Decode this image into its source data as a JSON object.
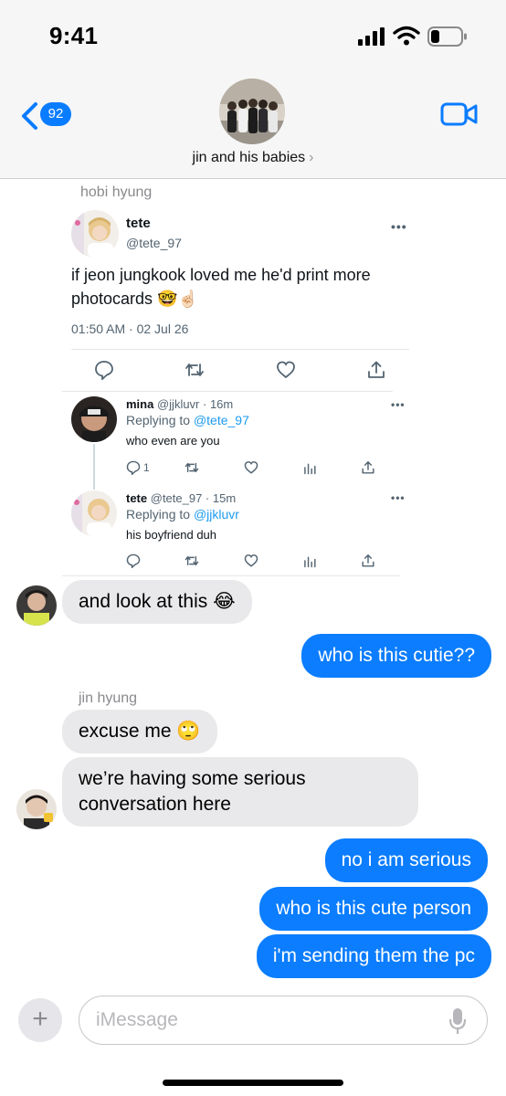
{
  "status_bar": {
    "time": "9:41"
  },
  "header": {
    "back_count": "92",
    "group_name": "jin and his babies",
    "chevron": "›"
  },
  "chat": {
    "sender1": "hobi hyung",
    "tweet": {
      "name": "tete",
      "handle": "@tete_97",
      "more": "•••",
      "text_line1": "if jeon jungkook loved me he'd print more",
      "text_line2": "photocards 🤓☝🏻",
      "timestamp": "01:50 AM · 02 Jul 26",
      "reply1": {
        "name": "mina",
        "meta": "@jjkluvr · 16m",
        "replying_prefix": "Replying to ",
        "replying_to": "@tete_97",
        "text": "who even are you",
        "reply_count": "1"
      },
      "reply2": {
        "name": "tete",
        "meta": "@tete_97 · 15m",
        "replying_prefix": "Replying to ",
        "replying_to": "@jjkluvr",
        "text": "his boyfriend duh"
      }
    },
    "msg1": "and look at this 😂",
    "msg2": "who is this cutie??",
    "sender2": "jin hyung",
    "msg3": "excuse me 🙄",
    "msg4_line1": "we’re having some serious",
    "msg4_line2": "conversation here",
    "msg5": "no i am serious",
    "msg6": "who is this cute person",
    "msg7": "i'm sending them the pc"
  },
  "compose": {
    "placeholder": "iMessage",
    "plus": "+"
  },
  "colors": {
    "accent": "#0b7dfe",
    "incoming": "#e9e9eb",
    "twitter_blue": "#1d9bf0"
  },
  "icons": [
    "signal-icon",
    "wifi-icon",
    "battery-icon",
    "back-chevron-icon",
    "video-camera-icon",
    "reply-icon",
    "retweet-icon",
    "like-icon",
    "share-icon",
    "analytics-icon",
    "microphone-icon",
    "plus-icon"
  ]
}
